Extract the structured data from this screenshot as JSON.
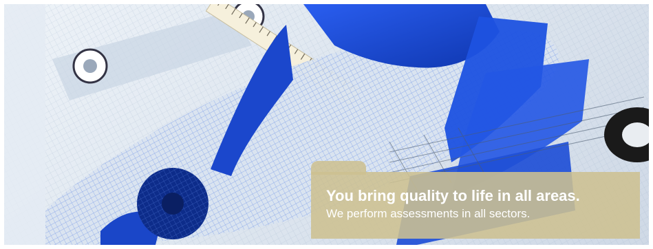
{
  "banner": {
    "headline": "You bring quality to life in all areas.",
    "subline": "We perform assessments in all sectors."
  },
  "image": {
    "subject": "wireframe-car-blueprint",
    "accent_blue": "#1f4fd6",
    "caption_bg": "#cdc091"
  }
}
